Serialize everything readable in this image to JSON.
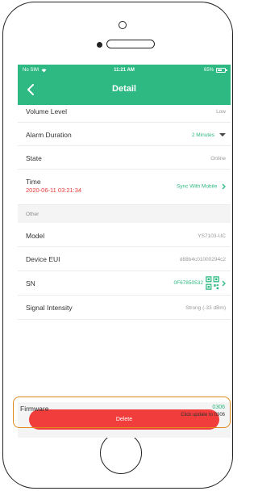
{
  "status_bar": {
    "carrier": "No SIM",
    "time": "11:21 AM",
    "battery": "65%",
    "battery_level": 0.65
  },
  "nav": {
    "title": "Detail"
  },
  "rows": {
    "volume": {
      "label": "Volume Level",
      "value": "Low"
    },
    "alarm": {
      "label": "Alarm Duration",
      "value": "2 Minutes"
    },
    "state": {
      "label": "State",
      "value": "Online"
    },
    "time": {
      "label": "Time",
      "date": "2020-06-11 03:21:34",
      "action": "Sync With Mobile"
    },
    "other_section": {
      "label": "Other"
    },
    "model": {
      "label": "Model",
      "value": "YS7103-UC"
    },
    "device_eui": {
      "label": "Device EUI",
      "value": "d88b4c01000294c2"
    },
    "sn": {
      "label": "SN",
      "value": "0F67850532"
    },
    "signal": {
      "label": "Signal Intensity",
      "value": "Strong (-33 dBm)"
    },
    "firmware": {
      "label": "Firmware",
      "version": "0306",
      "hint": "Click update to 0306"
    }
  },
  "actions": {
    "delete_label": "Delete"
  },
  "colors": {
    "accent": "#2eb882",
    "danger": "#f23d3d",
    "highlight": "#e08a1e",
    "date_red": "#e53935"
  }
}
